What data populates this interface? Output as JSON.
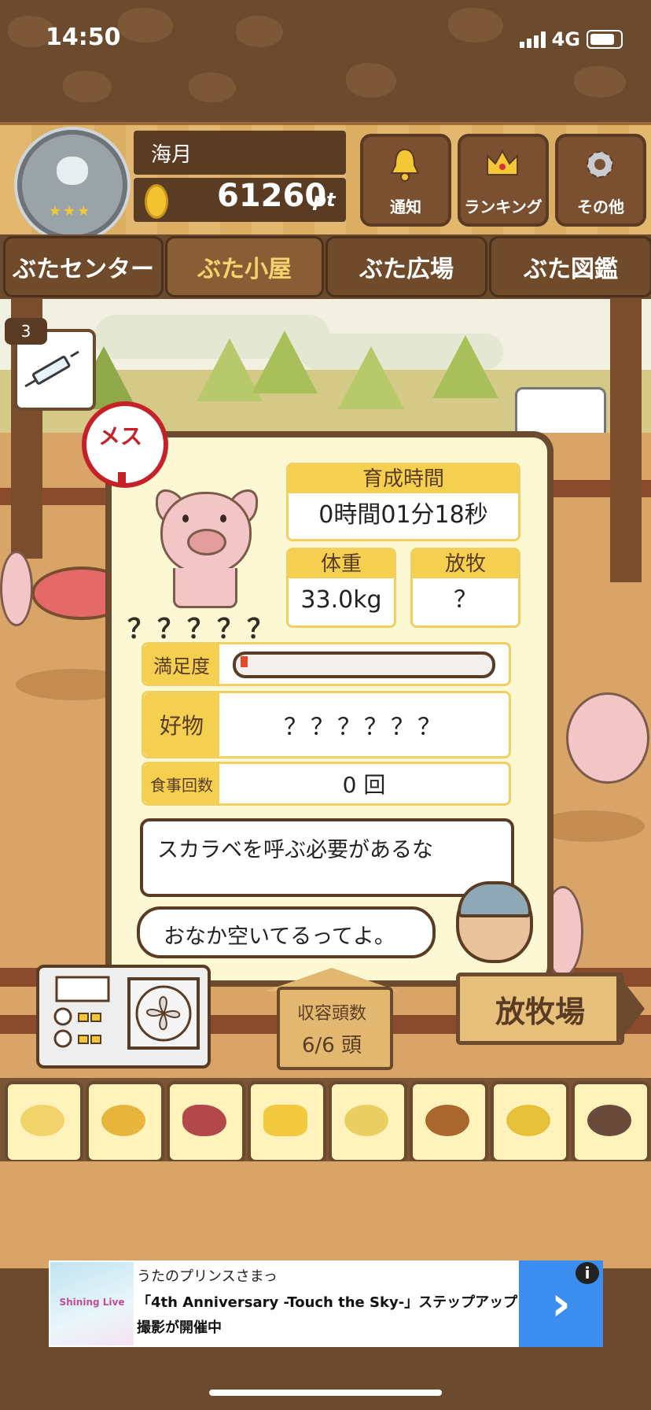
{
  "status": {
    "time": "14:50",
    "network": "4G"
  },
  "header": {
    "player_name": "海月",
    "points": "61260",
    "points_unit": "pt",
    "rank_stars": 3,
    "buttons": [
      {
        "label": "通知",
        "icon": "bell-icon"
      },
      {
        "label": "ランキング",
        "icon": "crown-icon"
      },
      {
        "label": "その他",
        "icon": "gear-icon"
      }
    ]
  },
  "nav": {
    "tabs": [
      {
        "label": "ぶたセンター",
        "active": false
      },
      {
        "label": "ぶた小屋",
        "active": true
      },
      {
        "label": "ぶた広場",
        "active": false
      },
      {
        "label": "ぶた図鑑",
        "active": false
      }
    ]
  },
  "syringe": {
    "count": "3"
  },
  "pig": {
    "gender": "メス",
    "name": "？？？？？",
    "breeding_time_label": "育成時間",
    "breeding_time": "0時間01分18秒",
    "weight_label": "体重",
    "weight": "33.0kg",
    "graze_label": "放牧",
    "graze": "？",
    "satisfaction_label": "満足度",
    "satisfaction": 0.03,
    "favorite_label": "好物",
    "favorite": "？？？？？？",
    "meal_count_label": "食事回数",
    "meal_count": "0 回"
  },
  "dialog": {
    "speech1": "スカラベを呼ぶ必要があるな",
    "speech2": "おなか空いてるってよ。"
  },
  "capacity": {
    "label": "収容頭数",
    "value": "6/6 頭"
  },
  "pasture_sign": "放牧場",
  "food_items": [
    {
      "icon": "soybeans-icon",
      "color": "#f0d36a"
    },
    {
      "icon": "mixed-grain-icon",
      "color": "#e7b53c"
    },
    {
      "icon": "sweet-potato-icon",
      "color": "#b3484a"
    },
    {
      "icon": "corn-icon",
      "color": "#f0c93c"
    },
    {
      "icon": "ginkgo-nut-icon",
      "color": "#e9cf62"
    },
    {
      "icon": "acorn-icon",
      "color": "#a9672f"
    },
    {
      "icon": "feed-bowl-icon",
      "color": "#e6c23a"
    },
    {
      "icon": "truffle-icon",
      "color": "#6a4a3a"
    }
  ],
  "ad": {
    "title": "うたのプリンスさまっ",
    "body": "「4th Anniversary -Touch the Sky-」ステップアップ撮影が開催中",
    "image_text": "Shining Live",
    "cta_icon": "chevron-right-icon",
    "info_icon": "info-icon"
  }
}
